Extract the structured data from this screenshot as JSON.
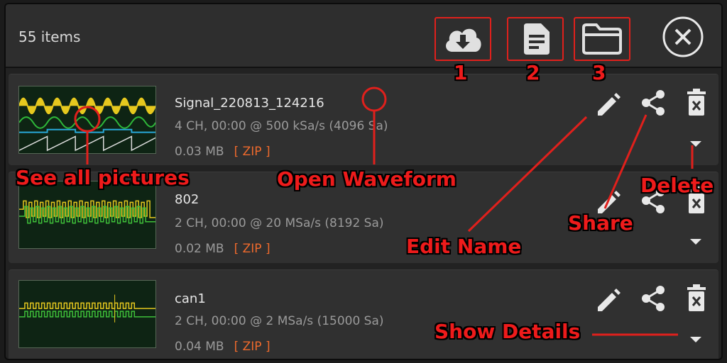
{
  "header": {
    "item_count": "55 items",
    "buttons": [
      {
        "name": "download",
        "icon": "cloud-download-icon"
      },
      {
        "name": "document",
        "icon": "document-icon"
      },
      {
        "name": "folder",
        "icon": "folder-icon"
      }
    ],
    "close_icon": "close-circle-icon"
  },
  "files": [
    {
      "name": "Signal_220813_124216",
      "info": "4 CH, 00:00 @ 500 kSa/s (4096 Sa)",
      "size": "0.03 MB",
      "badge": "[ ZIP ]"
    },
    {
      "name": "802",
      "info": "2 CH, 00:00 @ 20 MSa/s (8192 Sa)",
      "size": "0.02 MB",
      "badge": "[ ZIP ]"
    },
    {
      "name": "can1",
      "info": "2 CH, 00:00 @ 2 MSa/s (15000 Sa)",
      "size": "0.04 MB",
      "badge": "[ ZIP ]"
    }
  ],
  "annotations": {
    "num1": "1",
    "num2": "2",
    "num3": "3",
    "see_all_pictures": "See all pictures",
    "open_waveform": "Open Waveform",
    "delete": "Delete",
    "share": "Share",
    "edit_name": "Edit Name",
    "show_details": "Show Details"
  },
  "colors": {
    "annotation": "#ee1b1b",
    "zip": "#ef6a2c",
    "icon": "#e8e8e8",
    "background": "#222222"
  }
}
